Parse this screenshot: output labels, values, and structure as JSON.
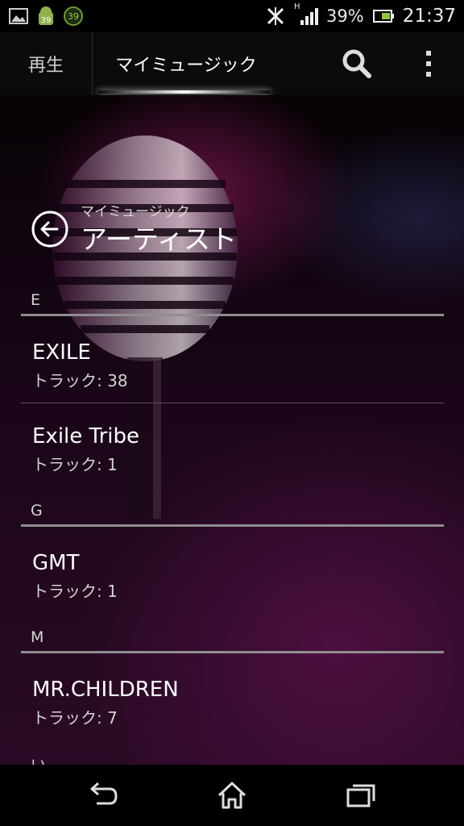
{
  "status_bar": {
    "notif_icons": [
      "gallery-icon",
      "android-update-icon",
      "update-count-badge"
    ],
    "notif_badge_1": "39",
    "notif_badge_2": "39",
    "signal_label": "H",
    "battery_percent": "39%",
    "time": "21:37"
  },
  "tabs": {
    "play_label": "再生",
    "mymusic_label": "マイミュージック"
  },
  "header": {
    "breadcrumb": "マイミュージック",
    "title": "アーティスト"
  },
  "sections": [
    {
      "letter": "E",
      "artists": [
        {
          "name": "EXILE",
          "tracks": "トラック: 38"
        },
        {
          "name": "Exile Tribe",
          "tracks": "トラック: 1"
        }
      ]
    },
    {
      "letter": "G",
      "artists": [
        {
          "name": "GMT",
          "tracks": "トラック: 1"
        }
      ]
    },
    {
      "letter": "M",
      "artists": [
        {
          "name": "MR.CHILDREN",
          "tracks": "トラック: 7"
        }
      ]
    }
  ],
  "partial_section_letter": "い",
  "colors": {
    "accent": "#ffffff",
    "background_purple": "#2b0a26",
    "divider": "#8e8e8e"
  }
}
